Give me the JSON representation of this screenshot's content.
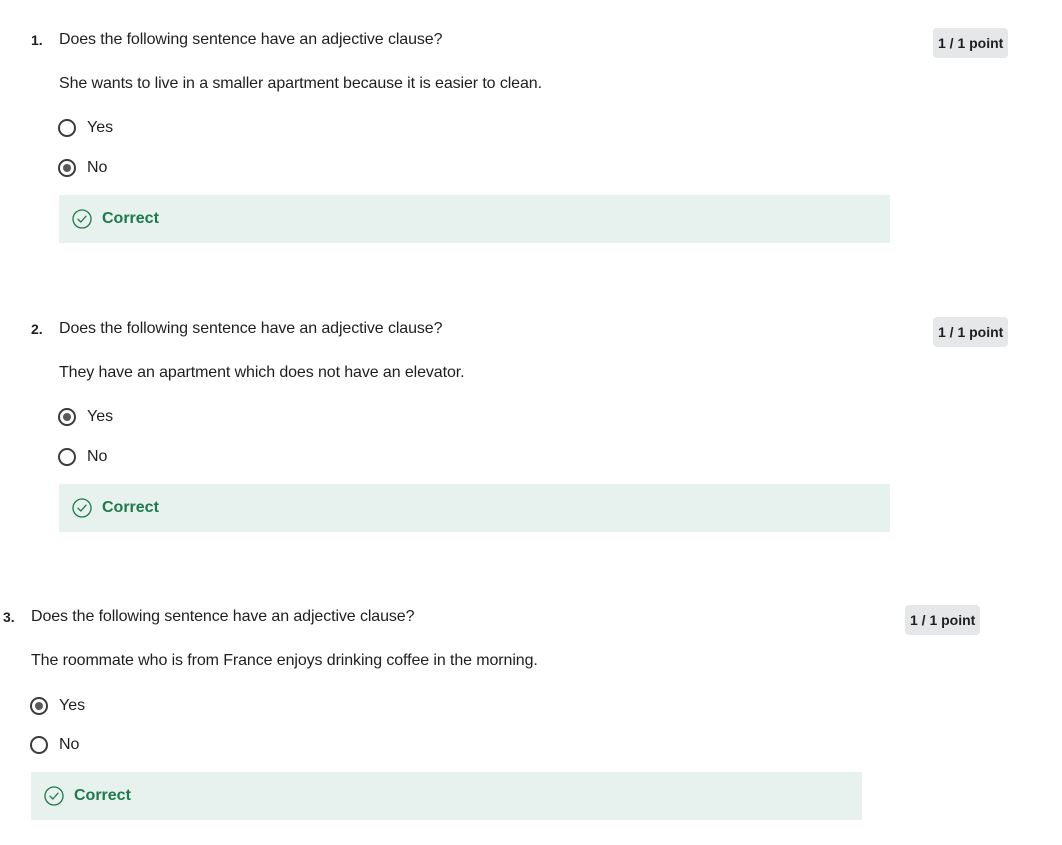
{
  "questions": [
    {
      "number": "1.",
      "prompt": "Does the following sentence have an adjective clause?",
      "sentence": "She wants to live in a smaller apartment because it is easier to clean.",
      "points": "1 / 1 point",
      "options": [
        {
          "label": "Yes",
          "selected": false
        },
        {
          "label": "No",
          "selected": true
        }
      ],
      "feedback": "Correct"
    },
    {
      "number": "2.",
      "prompt": "Does the following sentence have an adjective clause?",
      "sentence": "They have an apartment which does not have an elevator.",
      "points": "1 / 1 point",
      "options": [
        {
          "label": "Yes",
          "selected": true
        },
        {
          "label": "No",
          "selected": false
        }
      ],
      "feedback": "Correct"
    },
    {
      "number": "3.",
      "prompt": "Does the following sentence have an adjective clause?",
      "sentence": "The roommate who is from France enjoys drinking coffee in the morning.",
      "points": "1 / 1 point",
      "options": [
        {
          "label": "Yes",
          "selected": true
        },
        {
          "label": "No",
          "selected": false
        }
      ],
      "feedback": "Correct"
    }
  ],
  "icons": {
    "feedback": "check-circle-icon",
    "option": "radio-icon"
  },
  "colors": {
    "correct_text": "#1d7a4a",
    "correct_background": "#e7f1ee",
    "points_badge_background": "#e5e7e8"
  }
}
